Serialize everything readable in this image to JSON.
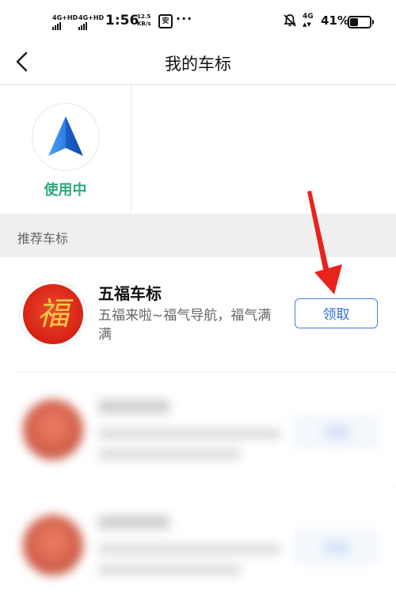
{
  "status_bar": {
    "sim1": "4G+HD",
    "sim2": "4G+HD",
    "time": "1:56",
    "speed_value": "12.5",
    "speed_unit": "KB/s",
    "app_badge": "安",
    "more": "···",
    "net": "4G",
    "battery_percent": "41%"
  },
  "header": {
    "title": "我的车标"
  },
  "current": {
    "status_label": "使用中"
  },
  "section": {
    "title": "推荐车标"
  },
  "items": [
    {
      "name": "五福车标",
      "description": "五福来啦~福气导航，福气满满",
      "avatar_char": "福",
      "button_label": "领取"
    },
    {
      "button_label": "领取"
    },
    {
      "button_label": "领取"
    }
  ],
  "colors": {
    "accent_blue": "#2f6fd6",
    "in_use_green": "#2eaa7a",
    "annotation_red": "#e8231c",
    "marker_blue": "#1e6ad6"
  }
}
